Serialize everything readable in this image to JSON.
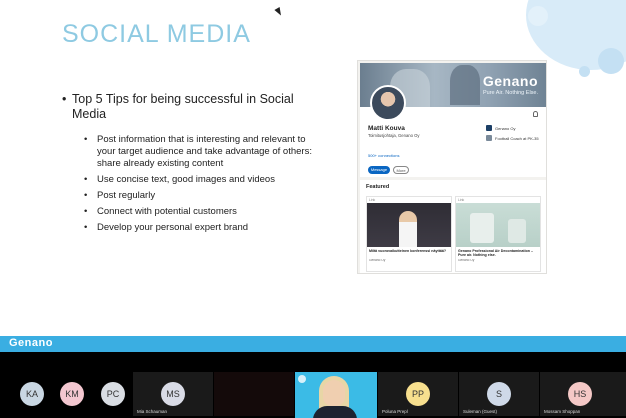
{
  "slide": {
    "title": "SOCIAL MEDIA",
    "main_bullet": "Top 5 Tips for being successful in Social Media",
    "sub_bullets": [
      "Post information that is interesting and relevant to your target audience and take advantage of others: share already existing content",
      "Use concise text, good images and videos",
      "Post regularly",
      "Connect with potential customers",
      "Develop your personal expert brand"
    ],
    "bullet_glyph": "•"
  },
  "linkedin": {
    "banner_logo": "Genano",
    "banner_tagline": "Pure Air. Nothing Else.",
    "name": "Matti Kouva",
    "headline": "Toimitusjohtaja, Genano Oy",
    "connections": "500+ connections",
    "message_button": "Message",
    "more_button": "More",
    "companies": [
      "Genano Oy",
      "Football Coach at PK-35"
    ],
    "featured_title": "Featured",
    "posts": [
      {
        "kind": "Link",
        "title": "Miltä vuorovaikutteinen konferenssi näyttää?",
        "text": "Genano Oy"
      },
      {
        "kind": "Link",
        "title": "Genano Professional Air Decontamination – Pure air. Nothing else.",
        "text": "Genano Oy"
      }
    ]
  },
  "brand_bar": {
    "logo": "Genano"
  },
  "participants": [
    {
      "initials": "KA",
      "color": "#c9d7e3"
    },
    {
      "initials": "KM",
      "color": "#f3c7d0"
    },
    {
      "initials": "PC",
      "color": "#d9dde3"
    },
    {
      "initials": "MS",
      "color": "#d9dbe6",
      "name": "Mia Schauman"
    },
    {
      "initials": "PP",
      "color": "#f7df8e",
      "name": "Poluna Prepl"
    },
    {
      "initials": "S",
      "color": "#cfd9e8",
      "name": "Suleman (Guest)"
    },
    {
      "initials": "HS",
      "color": "#f4c8c6",
      "name": "Mossam Shoppan"
    }
  ]
}
